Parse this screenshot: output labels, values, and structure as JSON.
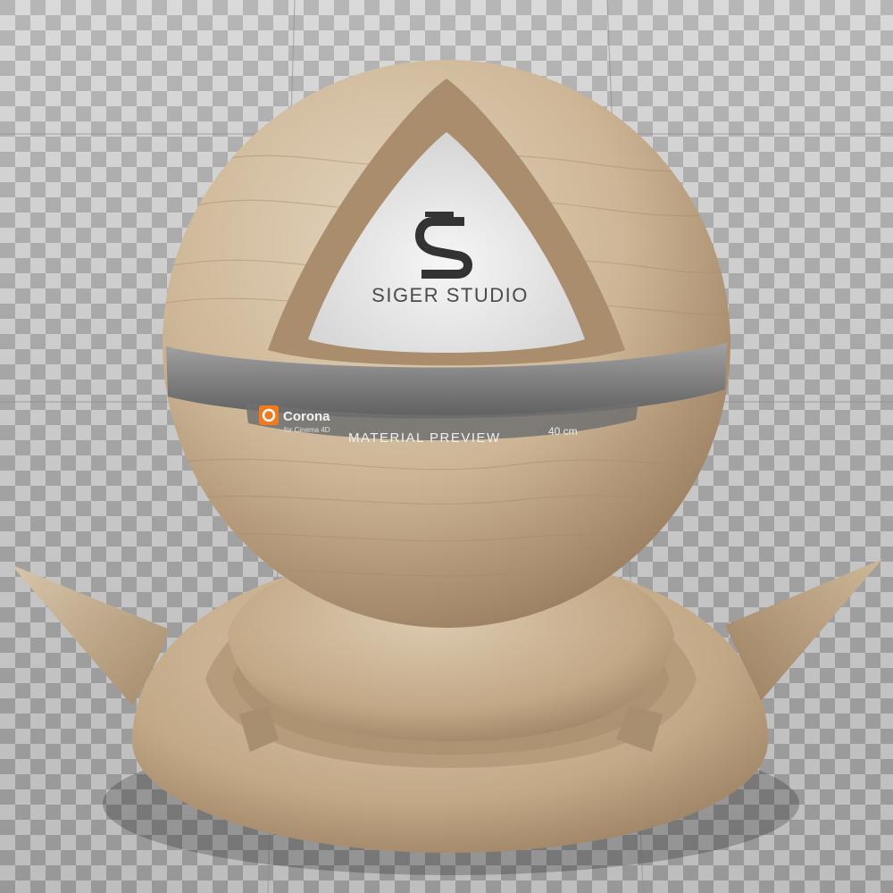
{
  "brand": {
    "studio_name": "SIGER STUDIO",
    "logo_letter": "S"
  },
  "band": {
    "renderer_name": "Corona",
    "renderer_sub": "for Cinema 4D",
    "title": "MATERIAL PREVIEW",
    "scale": "40 cm"
  },
  "colors": {
    "wood_light": "#d9c7ad",
    "wood_mid": "#c4ab8b",
    "wood_dark": "#8f7558",
    "band_gray": "#7a7a7a",
    "corona_orange": "#f07a1e",
    "checker_light": "#d4d4d4",
    "checker_dark": "#a8a8a8"
  }
}
